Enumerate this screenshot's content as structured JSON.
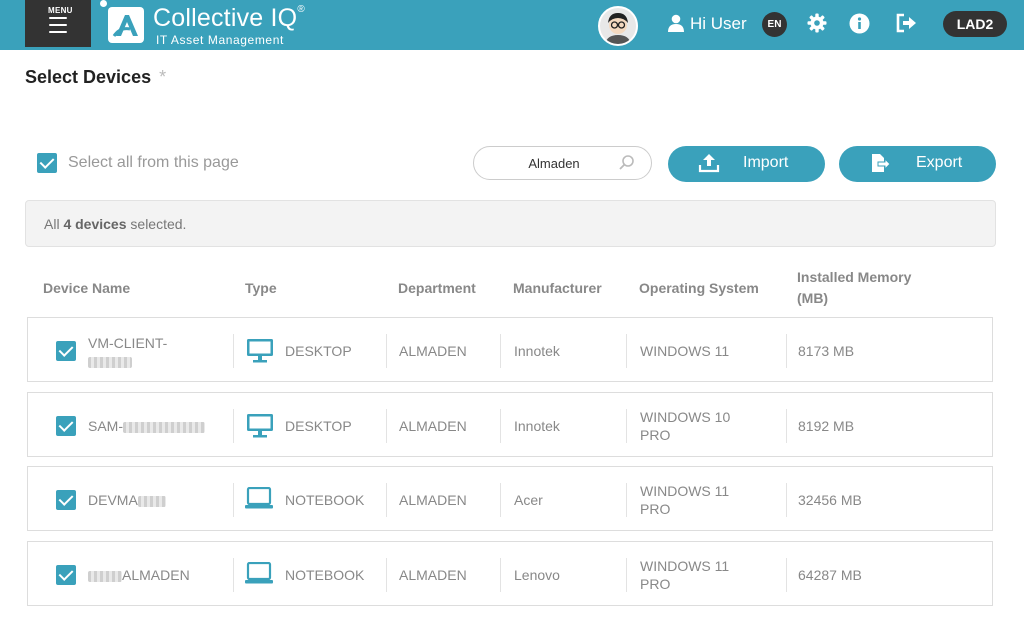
{
  "header": {
    "menu_label": "MENU",
    "brand_name": "Collective IQ",
    "brand_reg": "®",
    "brand_tagline": "IT Asset Management",
    "greeting": "Hi User",
    "language": "EN",
    "environment": "LAD2",
    "brand_color": "#3aa1bb",
    "icons": [
      "menu-icon",
      "user-icon",
      "gear-icon",
      "info-icon",
      "logout-icon"
    ]
  },
  "page": {
    "title": "Select Devices",
    "required_mark": "*",
    "select_all_label": "Select all from this page",
    "search": {
      "value": "Almaden",
      "placeholder": "Search"
    },
    "import_label": "Import",
    "export_label": "Export",
    "selection_notice": {
      "prefix": "All",
      "count": "4 devices",
      "suffix": "selected."
    }
  },
  "table": {
    "columns": [
      "Device Name",
      "Type",
      "Department",
      "Manufacturer",
      "Operating System",
      "Installed Memory (MB)"
    ],
    "rows": [
      {
        "name_line1": "VM-CLIENT-",
        "name_line2": "",
        "type": "DESKTOP",
        "type_icon": "desktop-icon",
        "department": "ALMADEN",
        "manufacturer": "Innotek",
        "os_line1": "WINDOWS 11",
        "os_line2": "",
        "memory": "8173 MB",
        "checked": true
      },
      {
        "name_line1": "SAM-",
        "name_line2": "",
        "type": "DESKTOP",
        "type_icon": "desktop-icon",
        "department": "ALMADEN",
        "manufacturer": "Innotek",
        "os_line1": "WINDOWS 10",
        "os_line2": "PRO",
        "memory": "8192 MB",
        "checked": true
      },
      {
        "name_line1": "DEVMA",
        "name_line2": "",
        "type": "NOTEBOOK",
        "type_icon": "notebook-icon",
        "department": "ALMADEN",
        "manufacturer": "Acer",
        "os_line1": "WINDOWS 11",
        "os_line2": "PRO",
        "memory": "32456 MB",
        "checked": true
      },
      {
        "name_line1": "ALMADEN",
        "name_line2": "",
        "type": "NOTEBOOK",
        "type_icon": "notebook-icon",
        "department": "ALMADEN",
        "manufacturer": "Lenovo",
        "os_line1": "WINDOWS 11",
        "os_line2": "PRO",
        "memory": "64287 MB",
        "checked": true
      }
    ]
  }
}
